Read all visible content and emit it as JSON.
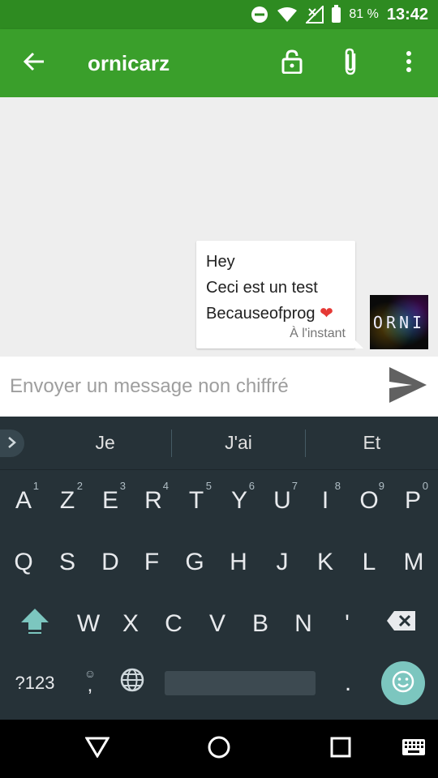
{
  "status_bar": {
    "battery_percent": "81 %",
    "time": "13:42",
    "icons": [
      "do-not-disturb-icon",
      "wifi-icon",
      "no-signal-icon",
      "battery-icon"
    ]
  },
  "app_bar": {
    "title": "ornicarz",
    "icons": [
      "back-arrow-icon",
      "unlock-icon",
      "attach-icon",
      "more-vert-icon"
    ]
  },
  "conversation": {
    "messages": [
      {
        "lines": [
          "Hey",
          "Ceci est un test",
          "Becauseofprog"
        ],
        "emoji": "❤",
        "time": "À l'instant",
        "sender_avatar_text": "ORNI"
      }
    ]
  },
  "compose": {
    "placeholder": "Envoyer un message non chiffré",
    "send_icon": "send-icon"
  },
  "keyboard": {
    "suggestions": [
      "Je",
      "J'ai",
      "Et"
    ],
    "row1": [
      {
        "k": "A",
        "n": "1"
      },
      {
        "k": "Z",
        "n": "2"
      },
      {
        "k": "E",
        "n": "3"
      },
      {
        "k": "R",
        "n": "4"
      },
      {
        "k": "T",
        "n": "5"
      },
      {
        "k": "Y",
        "n": "6"
      },
      {
        "k": "U",
        "n": "7"
      },
      {
        "k": "I",
        "n": "8"
      },
      {
        "k": "O",
        "n": "9"
      },
      {
        "k": "P",
        "n": "0"
      }
    ],
    "row2": [
      "Q",
      "S",
      "D",
      "F",
      "G",
      "H",
      "J",
      "K",
      "L",
      "M"
    ],
    "row3": [
      "W",
      "X",
      "C",
      "V",
      "B",
      "N",
      "'"
    ],
    "symbols_label": "?123",
    "emoji_hint": "☺",
    "comma_label": ",",
    "period_label": ".",
    "accent_color": "#7cc6bf"
  },
  "nav_bar": {
    "icons": [
      "back-triangle-icon",
      "home-circle-icon",
      "recents-square-icon",
      "keyboard-switch-icon"
    ]
  }
}
